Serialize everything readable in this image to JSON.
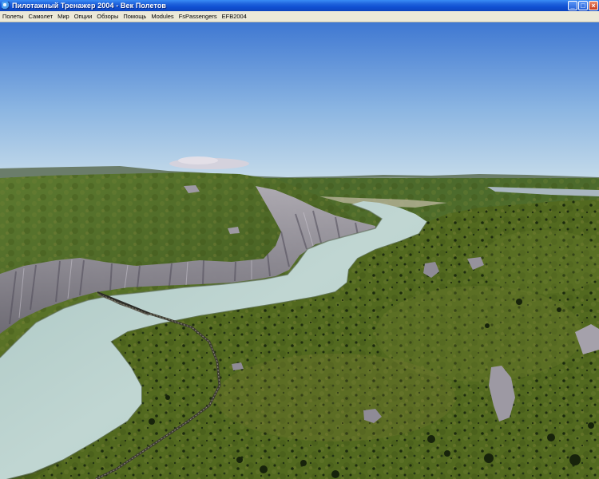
{
  "window": {
    "title": "Пилотажный Тренажер 2004 - Век Полетов"
  },
  "menu": {
    "items": [
      {
        "label": "Полеты",
        "name": "menu-flights"
      },
      {
        "label": "Самолет",
        "name": "menu-aircraft"
      },
      {
        "label": "Мир",
        "name": "menu-world"
      },
      {
        "label": "Опции",
        "name": "menu-options"
      },
      {
        "label": "Обзоры",
        "name": "menu-views"
      },
      {
        "label": "Помощь",
        "name": "menu-help"
      },
      {
        "label": "Modules",
        "name": "menu-modules"
      },
      {
        "label": "FsPassengers",
        "name": "menu-fspassengers"
      },
      {
        "label": "EFB2004",
        "name": "menu-efb2004"
      }
    ]
  },
  "colors": {
    "sky_top": "#3f78d2",
    "sky_horizon": "#c7dcea",
    "water": "#b7cfcb",
    "grass": "#566d22",
    "cliff": "#8e8996"
  }
}
